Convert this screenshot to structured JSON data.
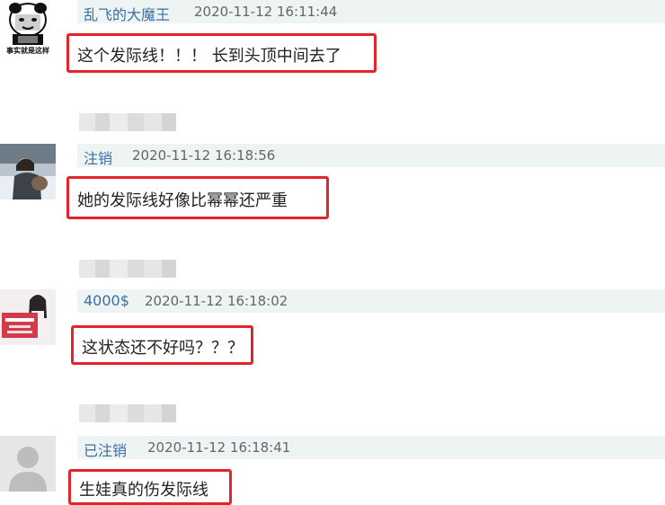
{
  "comments": [
    {
      "username": "乱飞的大魔王",
      "timestamp": "2020-11-12 16:11:44",
      "content": "这个发际线！！！ 长到头顶中间去了",
      "avatar_caption": "事实就是这样",
      "avatar_icon": "meme-panda-face"
    },
    {
      "username": "注销",
      "timestamp": "2020-11-12 16:18:56",
      "content": "她的发际线好像比幂幂还严重",
      "avatar_icon": "photo-person-in-snow"
    },
    {
      "username": "4000$",
      "timestamp": "2020-11-12 16:18:02",
      "content": "这状态还不好吗？？？",
      "avatar_icon": "photo-woman-with-sign"
    },
    {
      "username": "已注销",
      "timestamp": "2020-11-12 16:18:41",
      "content": "生娃真的伤发际线",
      "avatar_icon": "default-user-silhouette"
    }
  ],
  "colors": {
    "highlight_border": "#e0262b",
    "meta_bar": "#eef4f3",
    "username": "#3b6fa6"
  }
}
